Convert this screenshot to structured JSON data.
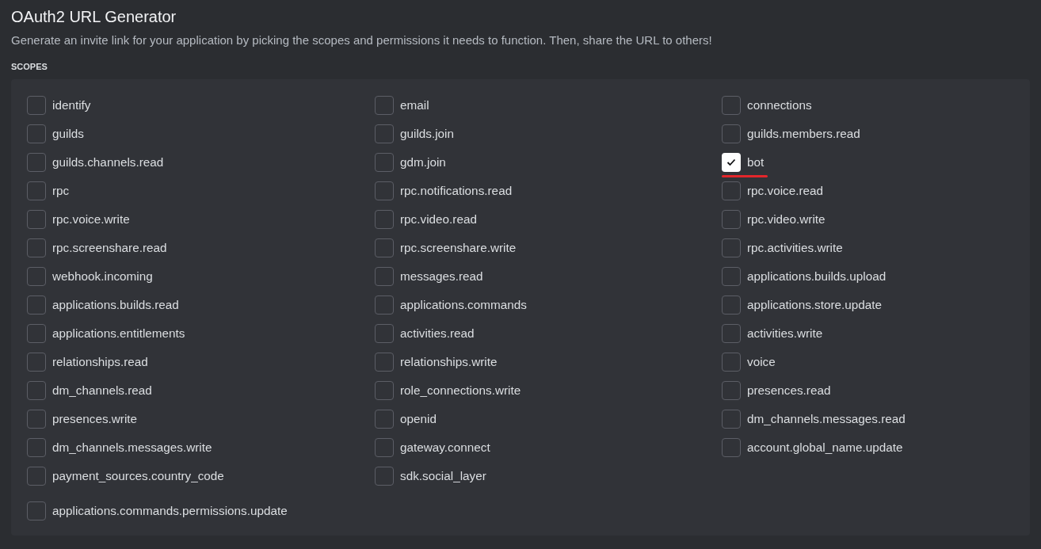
{
  "title": "OAuth2 URL Generator",
  "description": "Generate an invite link for your application by picking the scopes and permissions it needs to function. Then, share the URL to others!",
  "section_label": "SCOPES",
  "rows": [
    [
      {
        "label": "identify",
        "checked": false,
        "underlined": false
      },
      {
        "label": "email",
        "checked": false,
        "underlined": false
      },
      {
        "label": "connections",
        "checked": false,
        "underlined": false
      }
    ],
    [
      {
        "label": "guilds",
        "checked": false,
        "underlined": false
      },
      {
        "label": "guilds.join",
        "checked": false,
        "underlined": false
      },
      {
        "label": "guilds.members.read",
        "checked": false,
        "underlined": false
      }
    ],
    [
      {
        "label": "guilds.channels.read",
        "checked": false,
        "underlined": false
      },
      {
        "label": "gdm.join",
        "checked": false,
        "underlined": false
      },
      {
        "label": "bot",
        "checked": true,
        "underlined": true
      }
    ],
    [
      {
        "label": "rpc",
        "checked": false,
        "underlined": false
      },
      {
        "label": "rpc.notifications.read",
        "checked": false,
        "underlined": false
      },
      {
        "label": "rpc.voice.read",
        "checked": false,
        "underlined": false
      }
    ],
    [
      {
        "label": "rpc.voice.write",
        "checked": false,
        "underlined": false
      },
      {
        "label": "rpc.video.read",
        "checked": false,
        "underlined": false
      },
      {
        "label": "rpc.video.write",
        "checked": false,
        "underlined": false
      }
    ],
    [
      {
        "label": "rpc.screenshare.read",
        "checked": false,
        "underlined": false
      },
      {
        "label": "rpc.screenshare.write",
        "checked": false,
        "underlined": false
      },
      {
        "label": "rpc.activities.write",
        "checked": false,
        "underlined": false
      }
    ],
    [
      {
        "label": "webhook.incoming",
        "checked": false,
        "underlined": false
      },
      {
        "label": "messages.read",
        "checked": false,
        "underlined": false
      },
      {
        "label": "applications.builds.upload",
        "checked": false,
        "underlined": false
      }
    ],
    [
      {
        "label": "applications.builds.read",
        "checked": false,
        "underlined": false
      },
      {
        "label": "applications.commands",
        "checked": false,
        "underlined": false
      },
      {
        "label": "applications.store.update",
        "checked": false,
        "underlined": false
      }
    ],
    [
      {
        "label": "applications.entitlements",
        "checked": false,
        "underlined": false
      },
      {
        "label": "activities.read",
        "checked": false,
        "underlined": false
      },
      {
        "label": "activities.write",
        "checked": false,
        "underlined": false
      }
    ],
    [
      {
        "label": "relationships.read",
        "checked": false,
        "underlined": false
      },
      {
        "label": "relationships.write",
        "checked": false,
        "underlined": false
      },
      {
        "label": "voice",
        "checked": false,
        "underlined": false
      }
    ],
    [
      {
        "label": "dm_channels.read",
        "checked": false,
        "underlined": false
      },
      {
        "label": "role_connections.write",
        "checked": false,
        "underlined": false
      },
      {
        "label": "presences.read",
        "checked": false,
        "underlined": false
      }
    ],
    [
      {
        "label": "presences.write",
        "checked": false,
        "underlined": false
      },
      {
        "label": "openid",
        "checked": false,
        "underlined": false
      },
      {
        "label": "dm_channels.messages.read",
        "checked": false,
        "underlined": false
      }
    ],
    [
      {
        "label": "dm_channels.messages.write",
        "checked": false,
        "underlined": false
      },
      {
        "label": "gateway.connect",
        "checked": false,
        "underlined": false
      },
      {
        "label": "account.global_name.update",
        "checked": false,
        "underlined": false
      }
    ],
    [
      {
        "label": "payment_sources.country_code",
        "checked": false,
        "underlined": false
      },
      {
        "label": "sdk.social_layer",
        "checked": false,
        "underlined": false
      }
    ],
    [
      {
        "label": "applications.commands.permissions.update",
        "checked": false,
        "underlined": false
      }
    ]
  ]
}
